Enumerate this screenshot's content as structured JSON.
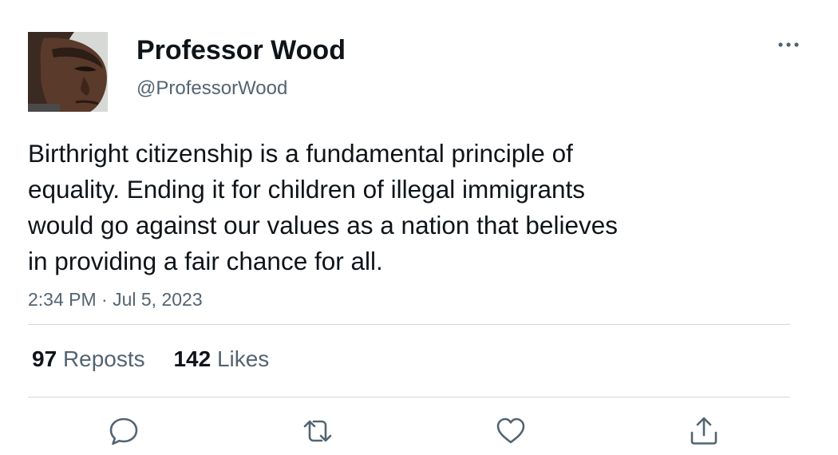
{
  "author": {
    "display_name": "Professor Wood",
    "handle": "@ProfessorWood"
  },
  "tweet": {
    "text_lines": [
      "Birthright citizenship is a fundamental principle of",
      "equality. Ending it for children of illegal immigrants",
      "would go against our values as a nation that believes",
      "in providing a fair chance for all."
    ],
    "timestamp": "2:34 PM · Jul 5, 2023"
  },
  "stats": {
    "reposts_count": "97",
    "reposts_label": "Reposts",
    "likes_count": "142",
    "likes_label": "Likes"
  },
  "icons": {
    "more": "more-horizontal-icon",
    "reply": "reply-bubble-icon",
    "repost": "repost-arrows-icon",
    "like": "heart-icon",
    "share": "share-upload-icon"
  },
  "colors": {
    "text_primary": "#0f1419",
    "text_secondary": "#536471",
    "divider": "#cfd9de",
    "icon": "#536471"
  }
}
